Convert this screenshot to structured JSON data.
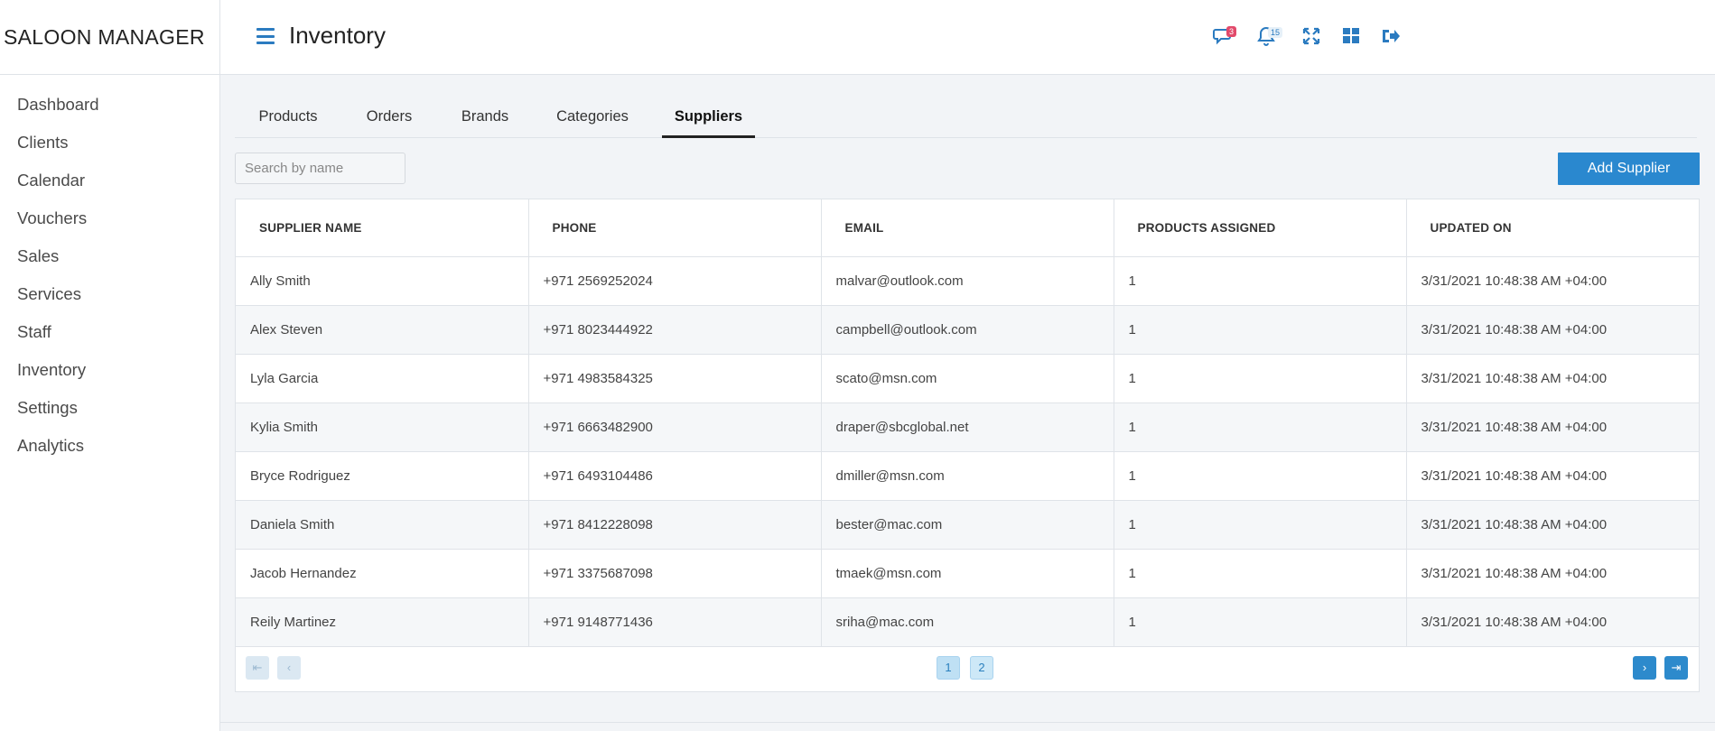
{
  "brand": "SALOON MANAGER",
  "sidebar": {
    "items": [
      {
        "label": "Dashboard"
      },
      {
        "label": "Clients"
      },
      {
        "label": "Calendar"
      },
      {
        "label": "Vouchers"
      },
      {
        "label": "Sales"
      },
      {
        "label": "Services"
      },
      {
        "label": "Staff"
      },
      {
        "label": "Inventory"
      },
      {
        "label": "Settings"
      },
      {
        "label": "Analytics"
      }
    ]
  },
  "header": {
    "title": "Inventory",
    "messages_badge": "3",
    "notifications_badge": "15",
    "icons": [
      "chat-icon",
      "bell-icon",
      "fullscreen-icon",
      "grid-icon",
      "logout-icon"
    ],
    "accent_color": "#2b7bc0"
  },
  "tabs": [
    {
      "label": "Products"
    },
    {
      "label": "Orders"
    },
    {
      "label": "Brands"
    },
    {
      "label": "Categories"
    },
    {
      "label": "Suppliers",
      "active": true
    }
  ],
  "search": {
    "placeholder": "Search by name",
    "value": ""
  },
  "add_button": "Add Supplier",
  "table": {
    "columns": [
      "SUPPLIER NAME",
      "PHONE",
      "EMAIL",
      "PRODUCTS ASSIGNED",
      "UPDATED ON"
    ],
    "rows": [
      [
        "Ally Smith",
        "+971 2569252024",
        "malvar@outlook.com",
        "1",
        "3/31/2021 10:48:38 AM +04:00"
      ],
      [
        "Alex Steven",
        "+971 8023444922",
        "campbell@outlook.com",
        "1",
        "3/31/2021 10:48:38 AM +04:00"
      ],
      [
        "Lyla Garcia",
        "+971 4983584325",
        "scato@msn.com",
        "1",
        "3/31/2021 10:48:38 AM +04:00"
      ],
      [
        "Kylia Smith",
        "+971 6663482900",
        "draper@sbcglobal.net",
        "1",
        "3/31/2021 10:48:38 AM +04:00"
      ],
      [
        "Bryce Rodriguez",
        "+971 6493104486",
        "dmiller@msn.com",
        "1",
        "3/31/2021 10:48:38 AM +04:00"
      ],
      [
        "Daniela Smith",
        "+971 8412228098",
        "bester@mac.com",
        "1",
        "3/31/2021 10:48:38 AM +04:00"
      ],
      [
        "Jacob Hernandez",
        "+971 3375687098",
        "tmaek@msn.com",
        "1",
        "3/31/2021 10:48:38 AM +04:00"
      ],
      [
        "Reily Martinez",
        "+971 9148771436",
        "sriha@mac.com",
        "1",
        "3/31/2021 10:48:38 AM +04:00"
      ]
    ]
  },
  "pagination": {
    "pages": [
      "1",
      "2"
    ],
    "current": "1",
    "first_glyph": "⇤",
    "prev_glyph": "‹",
    "next_glyph": "›",
    "last_glyph": "⇥"
  }
}
